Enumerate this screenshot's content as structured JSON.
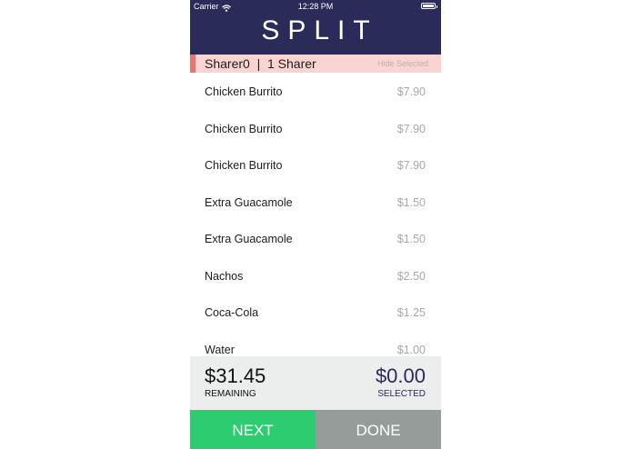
{
  "status_bar": {
    "carrier": "Carrier",
    "time": "12:28 PM"
  },
  "header": {
    "title": "SPLIT"
  },
  "sharer": {
    "label": "Sharer0  |  1 Sharer",
    "hide_selected": "Hide Selected"
  },
  "items": [
    {
      "name": "Chicken Burrito",
      "price": "$7.90"
    },
    {
      "name": "Chicken Burrito",
      "price": "$7.90"
    },
    {
      "name": "Chicken Burrito",
      "price": "$7.90"
    },
    {
      "name": "Extra Guacamole",
      "price": "$1.50"
    },
    {
      "name": "Extra Guacamole",
      "price": "$1.50"
    },
    {
      "name": "Nachos",
      "price": "$2.50"
    },
    {
      "name": "Coca-Cola",
      "price": "$1.25"
    },
    {
      "name": "Water",
      "price": "$1.00"
    }
  ],
  "totals": {
    "remaining_amount": "$31.45",
    "remaining_label": "REMAINING",
    "selected_amount": "$0.00",
    "selected_label": "SELECTED"
  },
  "buttons": {
    "next": "NEXT",
    "done": "DONE"
  },
  "colors": {
    "header_bg": "#2a2b58",
    "sharer_bg": "#f9d4d2",
    "sharer_accent": "#e9756f",
    "next_bg": "#2ecc71",
    "done_bg": "#959c99"
  }
}
